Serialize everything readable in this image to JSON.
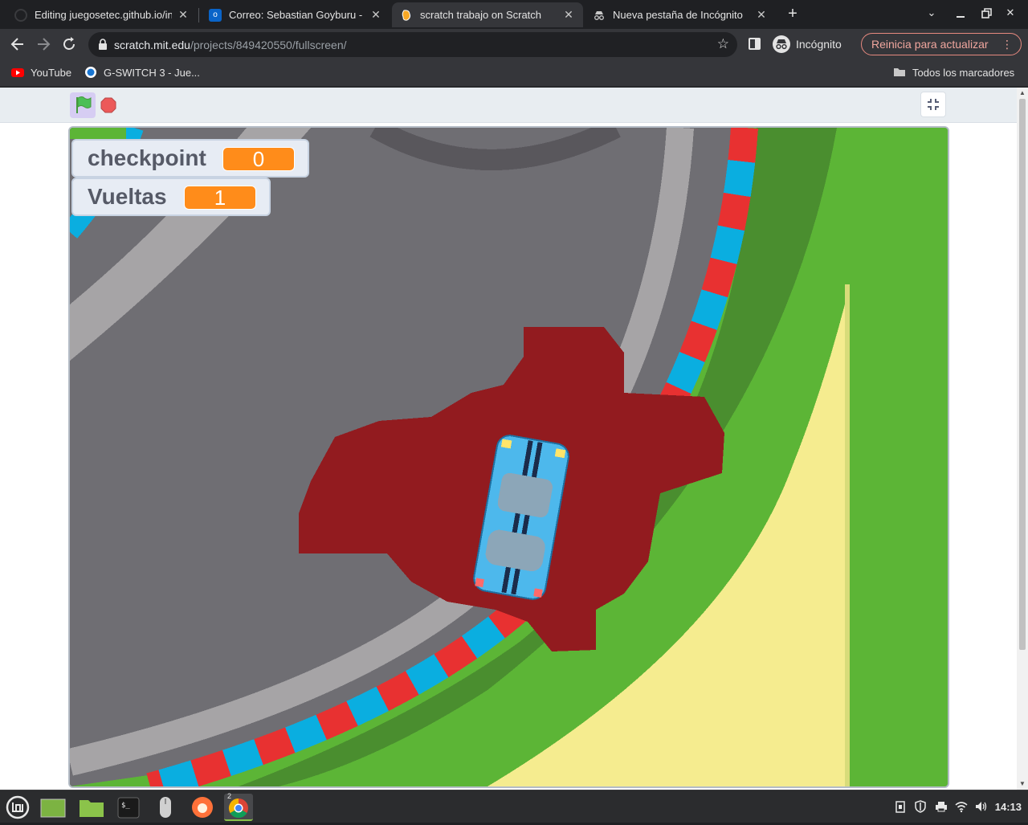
{
  "browser": {
    "tabs": [
      {
        "title": "Editing juegosetec.github.io/in",
        "active": false,
        "favicon": "github-icon"
      },
      {
        "title": "Correo: Sebastian Goyburu - O",
        "active": false,
        "favicon": "outlook-icon"
      },
      {
        "title": "scratch trabajo on Scratch",
        "active": true,
        "favicon": "scratch-icon"
      },
      {
        "title": "Nueva pestaña de Incógnito",
        "active": false,
        "favicon": "incognito-icon"
      }
    ],
    "url_host": "scratch.mit.edu",
    "url_path": "/projects/849420550/fullscreen/",
    "incognito_label": "Incógnito",
    "update_label": "Reinicia para actualizar",
    "bookmarks": [
      {
        "label": "YouTube",
        "icon": "youtube-icon"
      },
      {
        "label": "G-SWITCH 3 - Jue...",
        "icon": "gswitch-icon"
      }
    ],
    "all_bookmarks_label": "Todos los marcadores"
  },
  "scratch": {
    "monitors": [
      {
        "label": "checkpoint",
        "value": "0"
      },
      {
        "label": "Vueltas",
        "value": "1"
      }
    ]
  },
  "taskbar": {
    "clock": "14:13",
    "chrome_badge": "2"
  },
  "colors": {
    "accent_orange": "#ff8c1a",
    "track_gray": "#6f6e73",
    "grass_green": "#5cb536",
    "sand_yellow": "#f5ec8f",
    "oil_red": "#921b1f",
    "car_blue": "#4db8ec"
  }
}
